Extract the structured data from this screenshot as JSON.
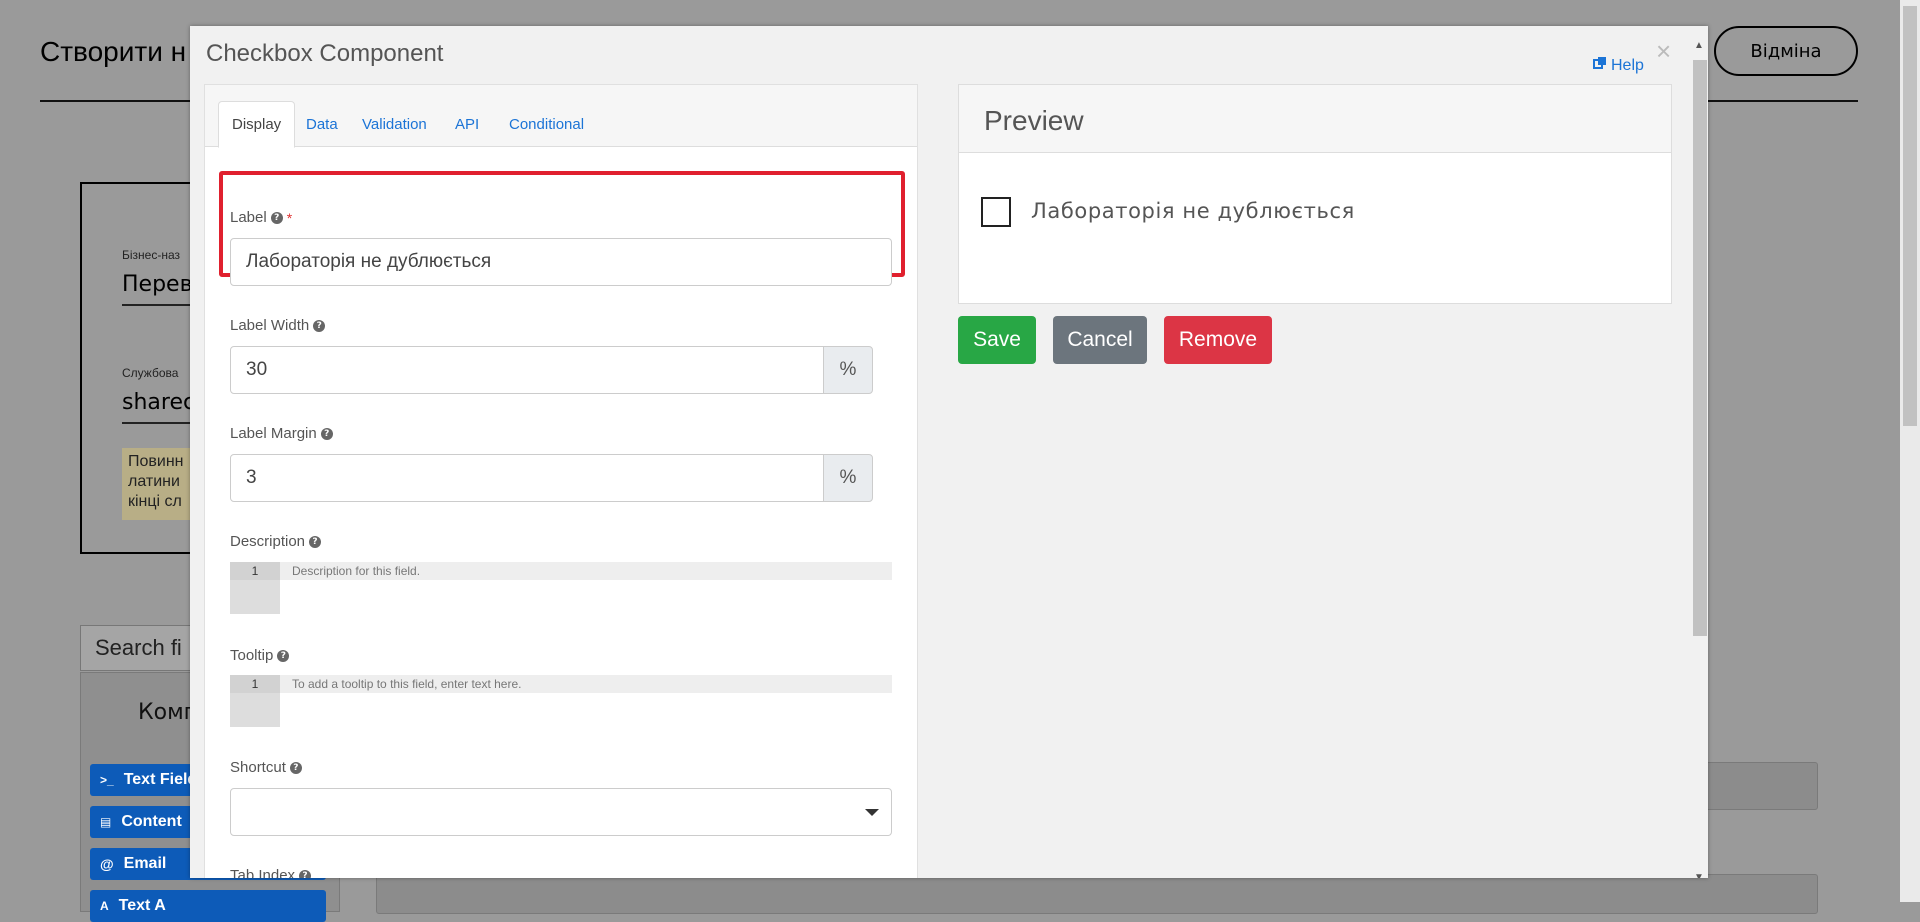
{
  "background": {
    "page_title": "Створити н",
    "cancel_label": "Відміна",
    "business_name_label": "Бізнес-наз",
    "business_name_value": "Перев",
    "service_label": "Службова",
    "service_value": "sharec",
    "hint_lines": [
      "Повинн",
      "латини",
      "кінці сл"
    ],
    "search_placeholder": "Search fi",
    "components_title": "Комп",
    "components": [
      {
        "icon": ">_",
        "label": "Text Field"
      },
      {
        "icon": "▤",
        "label": "Content"
      },
      {
        "icon": "@",
        "label": "Email"
      },
      {
        "icon": "A",
        "label": "Text A"
      }
    ]
  },
  "modal": {
    "title": "Checkbox Component",
    "help_label": "Help",
    "close_label": "×",
    "tabs": [
      {
        "label": "Display",
        "active": true
      },
      {
        "label": "Data",
        "active": false
      },
      {
        "label": "Validation",
        "active": false
      },
      {
        "label": "API",
        "active": false
      },
      {
        "label": "Conditional",
        "active": false
      }
    ],
    "fields": {
      "label": {
        "label": "Label",
        "required_mark": "*",
        "value": "Лабораторія не дублюється"
      },
      "label_width": {
        "label": "Label Width",
        "value": "30",
        "unit": "%"
      },
      "label_margin": {
        "label": "Label Margin",
        "value": "3",
        "unit": "%"
      },
      "description": {
        "label": "Description",
        "line_number": "1",
        "placeholder": "Description for this field."
      },
      "tooltip": {
        "label": "Tooltip",
        "line_number": "1",
        "placeholder": "To add a tooltip to this field, enter text here."
      },
      "shortcut": {
        "label": "Shortcut",
        "value": ""
      },
      "tab_index": {
        "label": "Tab Index"
      }
    },
    "preview": {
      "title": "Preview",
      "checkbox_label": "Лабораторія не дублюється",
      "checked": false
    },
    "buttons": {
      "save": "Save",
      "cancel": "Cancel",
      "remove": "Remove"
    }
  },
  "colors": {
    "accent_link": "#1c74d6",
    "save": "#28a745",
    "cancel": "#6c757d",
    "remove": "#dc3545",
    "highlight": "#e0202e"
  }
}
